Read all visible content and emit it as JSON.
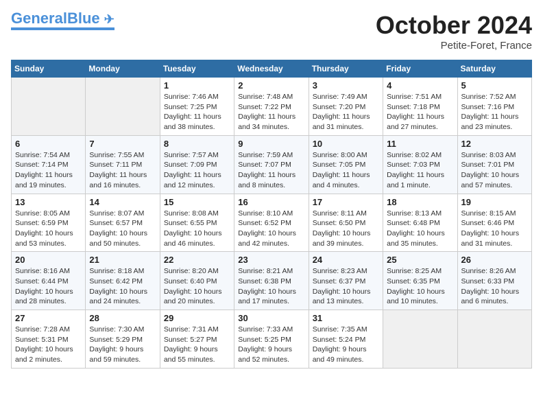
{
  "header": {
    "logo_general": "General",
    "logo_blue": "Blue",
    "month_title": "October 2024",
    "location": "Petite-Foret, France"
  },
  "weekdays": [
    "Sunday",
    "Monday",
    "Tuesday",
    "Wednesday",
    "Thursday",
    "Friday",
    "Saturday"
  ],
  "weeks": [
    [
      {
        "day": "",
        "sunrise": "",
        "sunset": "",
        "daylight": ""
      },
      {
        "day": "",
        "sunrise": "",
        "sunset": "",
        "daylight": ""
      },
      {
        "day": "1",
        "sunrise": "Sunrise: 7:46 AM",
        "sunset": "Sunset: 7:25 PM",
        "daylight": "Daylight: 11 hours and 38 minutes."
      },
      {
        "day": "2",
        "sunrise": "Sunrise: 7:48 AM",
        "sunset": "Sunset: 7:22 PM",
        "daylight": "Daylight: 11 hours and 34 minutes."
      },
      {
        "day": "3",
        "sunrise": "Sunrise: 7:49 AM",
        "sunset": "Sunset: 7:20 PM",
        "daylight": "Daylight: 11 hours and 31 minutes."
      },
      {
        "day": "4",
        "sunrise": "Sunrise: 7:51 AM",
        "sunset": "Sunset: 7:18 PM",
        "daylight": "Daylight: 11 hours and 27 minutes."
      },
      {
        "day": "5",
        "sunrise": "Sunrise: 7:52 AM",
        "sunset": "Sunset: 7:16 PM",
        "daylight": "Daylight: 11 hours and 23 minutes."
      }
    ],
    [
      {
        "day": "6",
        "sunrise": "Sunrise: 7:54 AM",
        "sunset": "Sunset: 7:14 PM",
        "daylight": "Daylight: 11 hours and 19 minutes."
      },
      {
        "day": "7",
        "sunrise": "Sunrise: 7:55 AM",
        "sunset": "Sunset: 7:11 PM",
        "daylight": "Daylight: 11 hours and 16 minutes."
      },
      {
        "day": "8",
        "sunrise": "Sunrise: 7:57 AM",
        "sunset": "Sunset: 7:09 PM",
        "daylight": "Daylight: 11 hours and 12 minutes."
      },
      {
        "day": "9",
        "sunrise": "Sunrise: 7:59 AM",
        "sunset": "Sunset: 7:07 PM",
        "daylight": "Daylight: 11 hours and 8 minutes."
      },
      {
        "day": "10",
        "sunrise": "Sunrise: 8:00 AM",
        "sunset": "Sunset: 7:05 PM",
        "daylight": "Daylight: 11 hours and 4 minutes."
      },
      {
        "day": "11",
        "sunrise": "Sunrise: 8:02 AM",
        "sunset": "Sunset: 7:03 PM",
        "daylight": "Daylight: 11 hours and 1 minute."
      },
      {
        "day": "12",
        "sunrise": "Sunrise: 8:03 AM",
        "sunset": "Sunset: 7:01 PM",
        "daylight": "Daylight: 10 hours and 57 minutes."
      }
    ],
    [
      {
        "day": "13",
        "sunrise": "Sunrise: 8:05 AM",
        "sunset": "Sunset: 6:59 PM",
        "daylight": "Daylight: 10 hours and 53 minutes."
      },
      {
        "day": "14",
        "sunrise": "Sunrise: 8:07 AM",
        "sunset": "Sunset: 6:57 PM",
        "daylight": "Daylight: 10 hours and 50 minutes."
      },
      {
        "day": "15",
        "sunrise": "Sunrise: 8:08 AM",
        "sunset": "Sunset: 6:55 PM",
        "daylight": "Daylight: 10 hours and 46 minutes."
      },
      {
        "day": "16",
        "sunrise": "Sunrise: 8:10 AM",
        "sunset": "Sunset: 6:52 PM",
        "daylight": "Daylight: 10 hours and 42 minutes."
      },
      {
        "day": "17",
        "sunrise": "Sunrise: 8:11 AM",
        "sunset": "Sunset: 6:50 PM",
        "daylight": "Daylight: 10 hours and 39 minutes."
      },
      {
        "day": "18",
        "sunrise": "Sunrise: 8:13 AM",
        "sunset": "Sunset: 6:48 PM",
        "daylight": "Daylight: 10 hours and 35 minutes."
      },
      {
        "day": "19",
        "sunrise": "Sunrise: 8:15 AM",
        "sunset": "Sunset: 6:46 PM",
        "daylight": "Daylight: 10 hours and 31 minutes."
      }
    ],
    [
      {
        "day": "20",
        "sunrise": "Sunrise: 8:16 AM",
        "sunset": "Sunset: 6:44 PM",
        "daylight": "Daylight: 10 hours and 28 minutes."
      },
      {
        "day": "21",
        "sunrise": "Sunrise: 8:18 AM",
        "sunset": "Sunset: 6:42 PM",
        "daylight": "Daylight: 10 hours and 24 minutes."
      },
      {
        "day": "22",
        "sunrise": "Sunrise: 8:20 AM",
        "sunset": "Sunset: 6:40 PM",
        "daylight": "Daylight: 10 hours and 20 minutes."
      },
      {
        "day": "23",
        "sunrise": "Sunrise: 8:21 AM",
        "sunset": "Sunset: 6:38 PM",
        "daylight": "Daylight: 10 hours and 17 minutes."
      },
      {
        "day": "24",
        "sunrise": "Sunrise: 8:23 AM",
        "sunset": "Sunset: 6:37 PM",
        "daylight": "Daylight: 10 hours and 13 minutes."
      },
      {
        "day": "25",
        "sunrise": "Sunrise: 8:25 AM",
        "sunset": "Sunset: 6:35 PM",
        "daylight": "Daylight: 10 hours and 10 minutes."
      },
      {
        "day": "26",
        "sunrise": "Sunrise: 8:26 AM",
        "sunset": "Sunset: 6:33 PM",
        "daylight": "Daylight: 10 hours and 6 minutes."
      }
    ],
    [
      {
        "day": "27",
        "sunrise": "Sunrise: 7:28 AM",
        "sunset": "Sunset: 5:31 PM",
        "daylight": "Daylight: 10 hours and 2 minutes."
      },
      {
        "day": "28",
        "sunrise": "Sunrise: 7:30 AM",
        "sunset": "Sunset: 5:29 PM",
        "daylight": "Daylight: 9 hours and 59 minutes."
      },
      {
        "day": "29",
        "sunrise": "Sunrise: 7:31 AM",
        "sunset": "Sunset: 5:27 PM",
        "daylight": "Daylight: 9 hours and 55 minutes."
      },
      {
        "day": "30",
        "sunrise": "Sunrise: 7:33 AM",
        "sunset": "Sunset: 5:25 PM",
        "daylight": "Daylight: 9 hours and 52 minutes."
      },
      {
        "day": "31",
        "sunrise": "Sunrise: 7:35 AM",
        "sunset": "Sunset: 5:24 PM",
        "daylight": "Daylight: 9 hours and 49 minutes."
      },
      {
        "day": "",
        "sunrise": "",
        "sunset": "",
        "daylight": ""
      },
      {
        "day": "",
        "sunrise": "",
        "sunset": "",
        "daylight": ""
      }
    ]
  ]
}
